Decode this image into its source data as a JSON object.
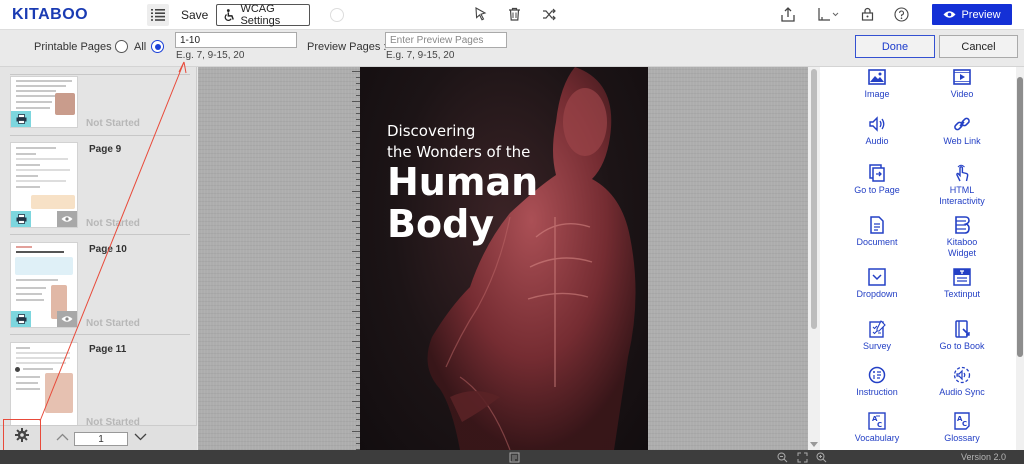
{
  "app": {
    "logo": "KITABOO",
    "version": "Version 2.0"
  },
  "toolbar": {
    "toc_icon": "toc-list-icon",
    "save_label": "Save",
    "wcag_label": "WCAG Settings",
    "wcag_icon": "accessibility-icon",
    "preview_label": "Preview",
    "icons": [
      "select-pointer-icon",
      "trash-icon",
      "shuffle-icon",
      "share-upload-icon",
      "layout-alignment-icon",
      "lock-icon",
      "help-icon",
      "eye-icon"
    ]
  },
  "print": {
    "printable_label": "Printable Pages :",
    "all_label": "All",
    "all_selected": false,
    "range_selected": true,
    "range_value": "1-10",
    "range_hint": "E.g. 7, 9-15, 20",
    "preview_label": "Preview Pages :",
    "preview_placeholder": "Enter Preview Pages",
    "preview_hint": "E.g. 7, 9-15, 20",
    "done_label": "Done",
    "cancel_label": "Cancel"
  },
  "thumbnails": [
    {
      "page_label": "",
      "status": "Not Started"
    },
    {
      "page_label": "Page 9",
      "status": "Not Started"
    },
    {
      "page_label": "Page 10",
      "status": "Not Started"
    },
    {
      "page_label": "Page 11",
      "status": "Not Started"
    }
  ],
  "pager": {
    "current_page": "1"
  },
  "book": {
    "subtitle_line1": "Discovering",
    "subtitle_line2": "the Wonders of the",
    "title_line1": "Human",
    "title_line2": "Body"
  },
  "widgets": [
    {
      "label": "Image",
      "icon": "image-icon"
    },
    {
      "label": "Video",
      "icon": "video-icon"
    },
    {
      "label": "Audio",
      "icon": "audio-speaker-icon"
    },
    {
      "label": "Web Link",
      "icon": "web-link-icon"
    },
    {
      "label": "Go to Page",
      "icon": "go-to-page-icon"
    },
    {
      "label": "HTML\nInteractivity",
      "icon": "touch-hand-icon"
    },
    {
      "label": "Document",
      "icon": "document-icon"
    },
    {
      "label": "Kitaboo\nWidget",
      "icon": "kitaboo-widget-icon"
    },
    {
      "label": "Dropdown",
      "icon": "dropdown-icon"
    },
    {
      "label": "Textinput",
      "icon": "textinput-icon"
    },
    {
      "label": "Survey",
      "icon": "survey-icon"
    },
    {
      "label": "Go to Book",
      "icon": "go-to-book-icon"
    },
    {
      "label": "Instruction",
      "icon": "instruction-icon"
    },
    {
      "label": "Audio Sync",
      "icon": "audio-sync-icon"
    },
    {
      "label": "Vocabulary",
      "icon": "vocabulary-icon"
    },
    {
      "label": "Glossary",
      "icon": "glossary-icon"
    }
  ],
  "colors": {
    "brand": "#1a3bb3",
    "primary_button": "#1430d6",
    "widget_accent": "#2440c5",
    "highlight_red": "#e84a3a"
  }
}
